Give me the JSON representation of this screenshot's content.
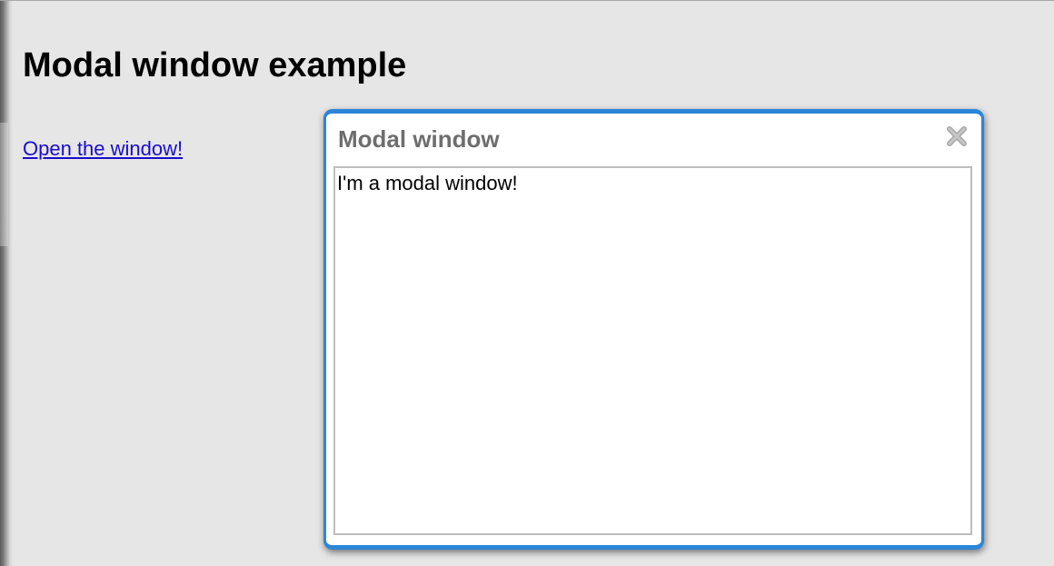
{
  "page": {
    "title": "Modal window example",
    "open_link_label": "Open the window!"
  },
  "modal": {
    "title": "Modal window",
    "close_icon": "close-icon",
    "message": "I'm a modal window!",
    "border_color": "#2b86d8"
  }
}
